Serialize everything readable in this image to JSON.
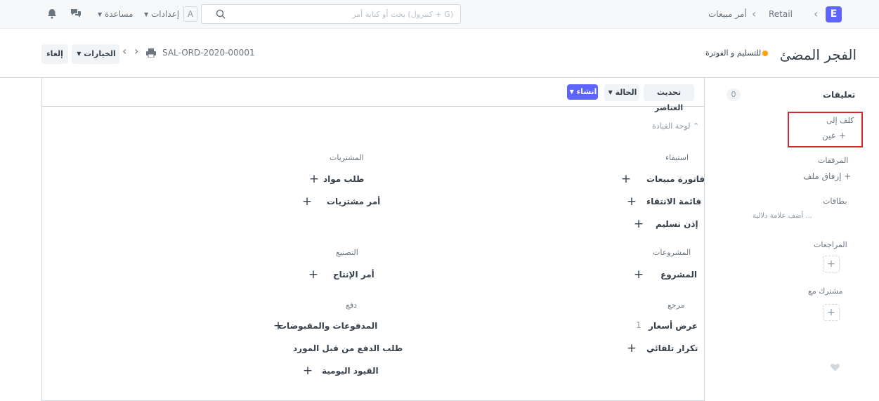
{
  "navbar": {
    "logo": "E",
    "breadcrumb": [
      "Retail",
      "أمر مبيعات"
    ],
    "search_placeholder": "بحث أو كتابة أمر (كنترول + G)",
    "avatar": "A",
    "settings": "إعدادات",
    "help": "مساعدة"
  },
  "header": {
    "title": "الفجر المضئ",
    "status": "للتسليم و الفوترة",
    "doc_name": "SAL-ORD-2020-00001",
    "options_btn": "الخيارات",
    "cancel_btn": "إلغاء"
  },
  "sidebar": {
    "comments_label": "تعليقات",
    "comments_count": "0",
    "assigned_label": "كلف إلى",
    "assign_action": "عين",
    "attachments_label": "المرفقات",
    "attach_action": "إرفاق ملف",
    "tags_label": "بطاقات",
    "add_tag": "أضف علامة دلالية ...",
    "reviewers_label": "المراجعات",
    "shared_label": "مشترك مع"
  },
  "toolbar": {
    "update_items": "تحديث العناصر",
    "status": "الحالة",
    "create": "انشاء"
  },
  "dashboard": {
    "section_title": "لوحة القيادة",
    "groups": [
      {
        "label": "استيفاء",
        "items": [
          {
            "name": "فاتورة مبيعات",
            "count": ""
          },
          {
            "name": "قائمة الانتقاء",
            "count": ""
          },
          {
            "name": "إذن تسليم",
            "count": ""
          }
        ]
      },
      {
        "label": "المشتريات",
        "items": [
          {
            "name": "طلب مواد",
            "count": ""
          },
          {
            "name": "أمر مشتريات",
            "count": ""
          }
        ]
      },
      {
        "label": "المشروعات",
        "items": [
          {
            "name": "المشروع",
            "count": ""
          }
        ]
      },
      {
        "label": "التصنيع",
        "items": [
          {
            "name": "أمر الإنتاج",
            "count": ""
          }
        ]
      },
      {
        "label": "مرجع",
        "items": [
          {
            "name": "عرض أسعار",
            "count": "1"
          },
          {
            "name": "تكرار تلقائي",
            "count": ""
          }
        ]
      },
      {
        "label": "دفع",
        "items": [
          {
            "name": "المدفوعات والمقبوضات",
            "count": ""
          },
          {
            "name": "طلب الدفع من قبل المورد",
            "count": ""
          },
          {
            "name": "القيود اليومية",
            "count": ""
          }
        ]
      }
    ]
  }
}
